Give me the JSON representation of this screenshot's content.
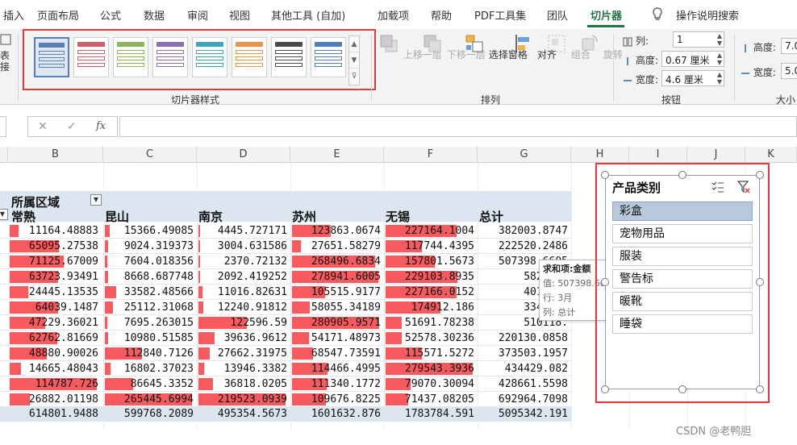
{
  "ribbon_tabs": [
    {
      "label": "插入"
    },
    {
      "label": "页面布局"
    },
    {
      "label": "公式"
    },
    {
      "label": "数据"
    },
    {
      "label": "审阅"
    },
    {
      "label": "视图"
    },
    {
      "label": "其他工具 (自加)"
    },
    {
      "label": "加载项"
    },
    {
      "label": "帮助"
    },
    {
      "label": "PDF工具集"
    },
    {
      "label": "团队"
    },
    {
      "label": "切片器"
    },
    {
      "label": "操作说明搜索"
    }
  ],
  "left_stub": {
    "line1": "表",
    "line2": "接"
  },
  "slicer_styles": {
    "group_label": "切片器样式",
    "colors": [
      "#5b7fb5",
      "#d06068",
      "#8cb45a",
      "#8a6fb5",
      "#3fa6b5",
      "#e6954a",
      "#4a4a4a",
      "#4f7fc0"
    ]
  },
  "arrange": {
    "group_label": "排列",
    "bring_forward": "上移一层",
    "send_backward": "下移一层",
    "selection_pane": "选择窗格",
    "align": "对齐",
    "group": "组合",
    "rotate": "旋转"
  },
  "buttons_group": {
    "group_label": "按钮",
    "columns_label": "列:",
    "columns_value": "1",
    "height_label": "高度:",
    "height_value": "0.67 厘米",
    "width_label": "宽度:",
    "width_value": "4.6 厘米"
  },
  "size_group": {
    "group_label": "大小",
    "height_label": "高度:",
    "height_value": "7.0",
    "width_label": "宽度:",
    "width_value": "5.0"
  },
  "formula_bar": {
    "cancel": "✕",
    "enter": "✓",
    "fx": "fx"
  },
  "columns": [
    "B",
    "C",
    "D",
    "E",
    "F",
    "G",
    "H",
    "I",
    "J",
    "K"
  ],
  "pivot": {
    "region_label": "所属区域",
    "col_names": [
      "常熟",
      "昆山",
      "南京",
      "苏州",
      "无锡",
      "总计"
    ],
    "rows": [
      [
        "11164.48883",
        "15366.49085",
        "4445.727171",
        "123863.0674",
        "227164.1004",
        "382003.8747"
      ],
      [
        "65095.27538",
        "9024.319373",
        "3004.631586",
        "27651.58279",
        "117744.4395",
        "222520.2486"
      ],
      [
        "71125.67009",
        "7604.018356",
        "2370.72132",
        "268496.6834",
        "157801.5673",
        "507398.6605"
      ],
      [
        "63723.93491",
        "8668.687748",
        "2092.419252",
        "278941.6005",
        "229103.8935",
        "582530."
      ],
      [
        "24445.13535",
        "33582.48566",
        "11016.82631",
        "105515.9177",
        "227166.0152",
        "401726."
      ],
      [
        "64039.1487",
        "25112.31068",
        "12240.91812",
        "58055.34189",
        "174912.186",
        "334359."
      ],
      [
        "47229.36021",
        "7695.263015",
        "122596.59",
        "280905.9571",
        "51691.78238",
        "510118."
      ],
      [
        "62762.81669",
        "10980.51585",
        "39636.9612",
        "54171.48973",
        "52578.30236",
        "220130.0858"
      ],
      [
        "48880.90026",
        "112840.7126",
        "27662.31975",
        "68547.73591",
        "115571.5272",
        "373503.1957"
      ],
      [
        "14665.48043",
        "16802.37023",
        "13946.3382",
        "114466.4995",
        "279543.3936",
        "434429.082"
      ],
      [
        "114787.726",
        "86645.3352",
        "36818.0205",
        "111340.1772",
        "79070.30094",
        "428661.5598"
      ],
      [
        "26882.01198",
        "265445.6994",
        "219523.0939",
        "109676.8225",
        "71437.08205",
        "692964.7098"
      ]
    ],
    "totals": [
      "614801.9488",
      "599768.2089",
      "495354.5673",
      "1601632.876",
      "1783784.591",
      "5095342.191"
    ]
  },
  "tooltip": {
    "title": "求和项:金额",
    "value": "值: 507398.6605",
    "row": "行: 3月",
    "col": "列: 总计"
  },
  "slicer": {
    "title": "产品类别",
    "items": [
      "彩盒",
      "宠物用品",
      "服装",
      "警告标",
      "暖靴",
      "睡袋"
    ],
    "selected_index": 0
  },
  "watermark": "CSDN @老鸭胆"
}
